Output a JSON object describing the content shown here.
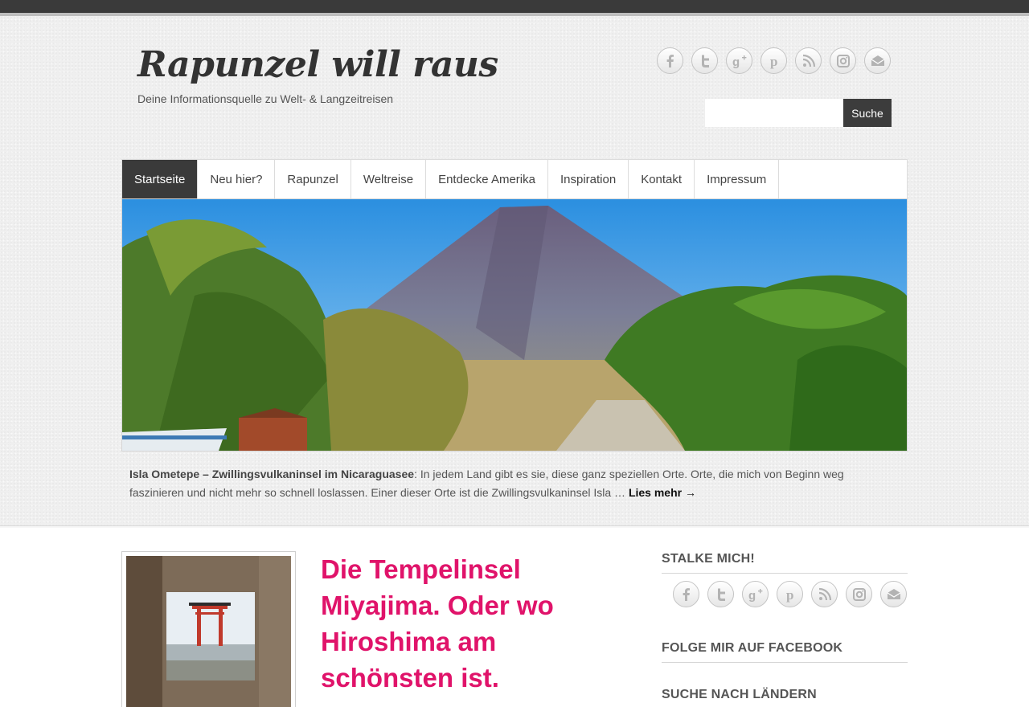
{
  "site": {
    "title": "Rapunzel will raus",
    "tagline": "Deine Informationsquelle zu Welt- & Langzeitreisen"
  },
  "social_icons": [
    "facebook-icon",
    "twitter-icon",
    "google-plus-icon",
    "pinterest-icon",
    "rss-icon",
    "instagram-icon",
    "email-icon"
  ],
  "search": {
    "value": "",
    "button_label": "Suche"
  },
  "nav": {
    "items": [
      {
        "label": "Startseite",
        "active": true
      },
      {
        "label": "Neu hier?"
      },
      {
        "label": "Rapunzel"
      },
      {
        "label": "Weltreise"
      },
      {
        "label": "Entdecke Amerika"
      },
      {
        "label": "Inspiration"
      },
      {
        "label": "Kontakt"
      },
      {
        "label": "Impressum"
      }
    ]
  },
  "featured": {
    "title": "Isla Ometepe – Zwillingsvulkaninsel im Nicaraguasee",
    "text": ": In jedem Land gibt es sie, diese ganz speziellen Orte. Orte, die mich von Beginn weg faszinieren und nicht mehr so schnell loslassen. Einer dieser Orte ist die Zwillingsvulkaninsel Isla … ",
    "readmore": "Lies mehr →"
  },
  "post": {
    "title": "Die Tempelinsel Miyajima. Oder wo Hiroshima am schönsten ist."
  },
  "sidebar": {
    "stalk_title": "STALKE MICH!",
    "facebook_title": "FOLGE MIR AUF FACEBOOK",
    "countries_title": "SUCHE NACH LÄNDERN"
  },
  "colors": {
    "accent_pink": "#e0136a",
    "nav_active": "#3a3a3a",
    "header_bg": "#efefef"
  }
}
